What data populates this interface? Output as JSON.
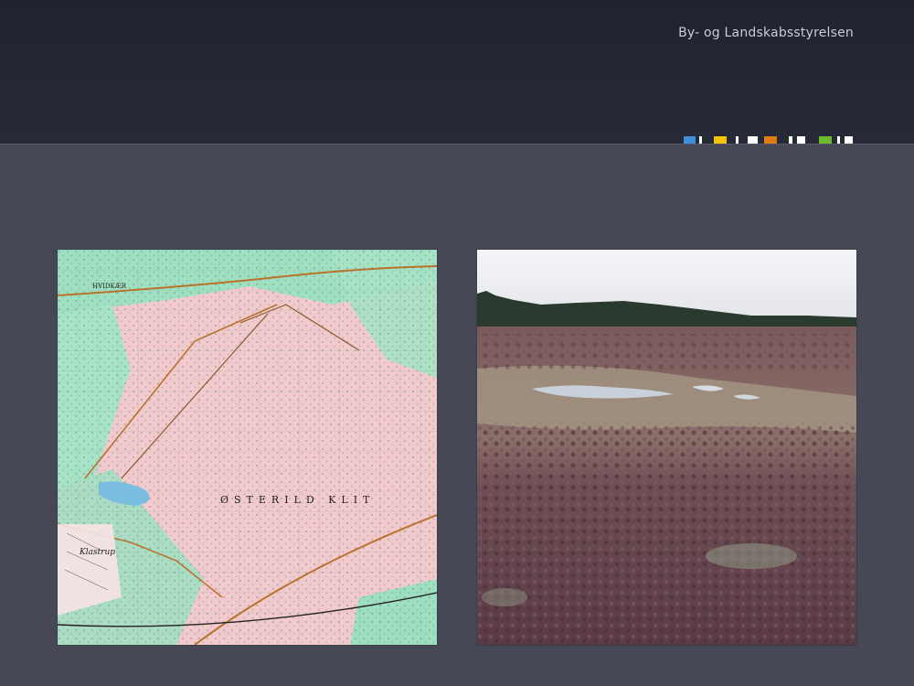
{
  "header": {
    "organization": "By- og Landskabsstyrelsen"
  },
  "colors": {
    "header_bg": "#22252f",
    "slide_bg": "#464955",
    "strip_blue": "#3d8fe0",
    "strip_yellow": "#f5c400",
    "strip_orange": "#e07a12",
    "strip_green": "#6cb92b",
    "strip_white": "#ffffff"
  },
  "images": {
    "map": {
      "icon": "topographic-map-image",
      "labels": {
        "place_1": "HVIDKÆR",
        "place_2": "ØSTERILD KLIT",
        "place_3": "Klastrup"
      }
    },
    "heath": {
      "icon": "heathland-photo"
    }
  }
}
